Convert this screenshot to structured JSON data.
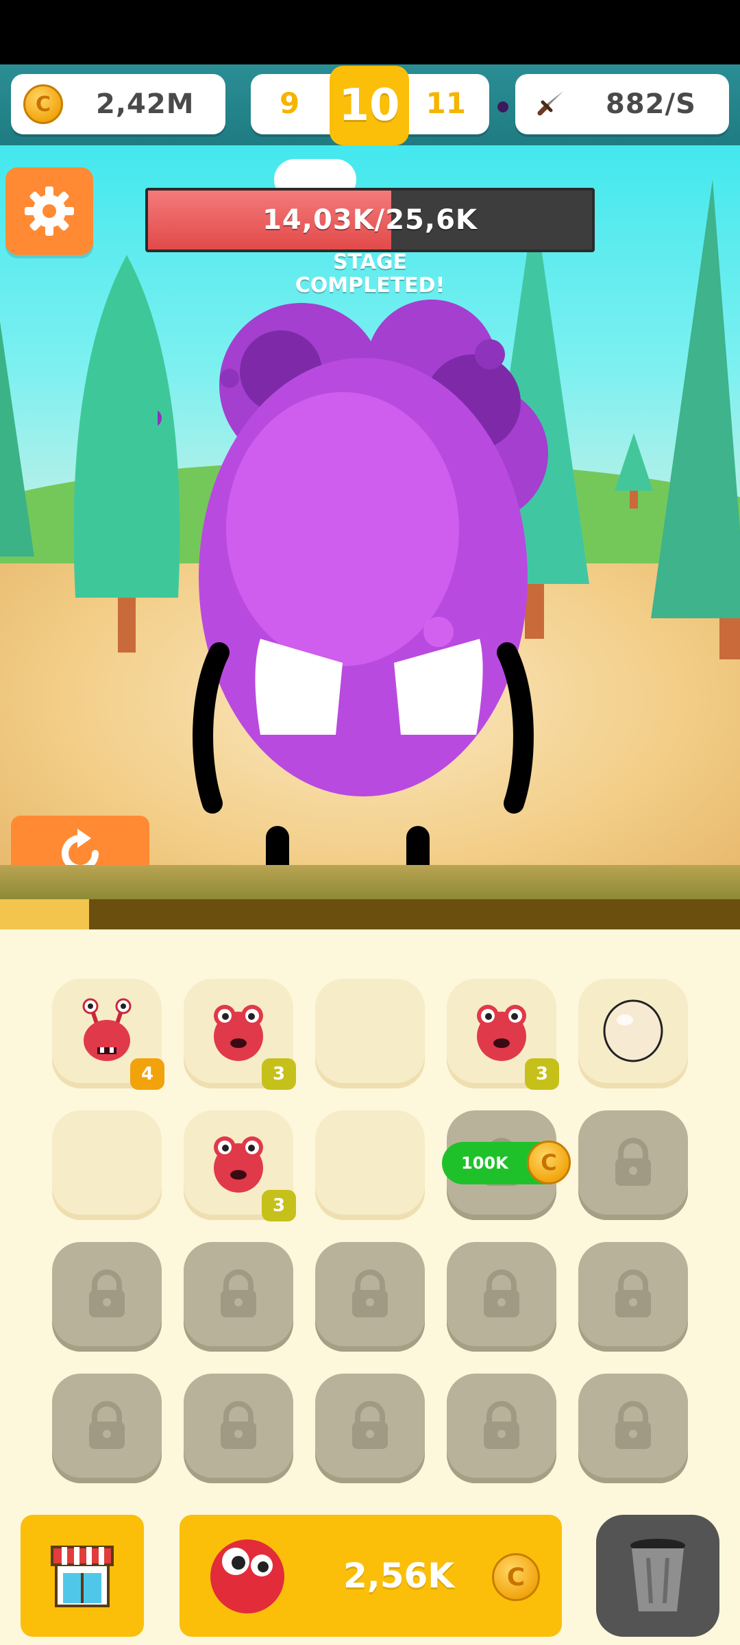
{
  "hud": {
    "coins": "2,42M",
    "coin_symbol": "C",
    "level_prev": "9",
    "level_current": "10",
    "level_next": "11",
    "dps": "882/S"
  },
  "boss": {
    "health_text": "14,03K/25,6K",
    "health_fraction": 0.548,
    "stage_line1": "STAGE",
    "stage_line2": "COMPLETED!"
  },
  "stage_progress_fraction": 0.12,
  "board": {
    "unlock_price": "100K",
    "slots": [
      {
        "state": "creature",
        "kind": "red-horn-monster",
        "level": "4"
      },
      {
        "state": "creature",
        "kind": "red-frog-monster",
        "level": "3"
      },
      {
        "state": "empty"
      },
      {
        "state": "creature",
        "kind": "red-frog-monster",
        "level": "3"
      },
      {
        "state": "egg"
      },
      {
        "state": "empty"
      },
      {
        "state": "creature",
        "kind": "red-frog-monster",
        "level": "3"
      },
      {
        "state": "empty"
      },
      {
        "state": "locked-purchasable"
      },
      {
        "state": "locked"
      },
      {
        "state": "locked"
      },
      {
        "state": "locked"
      },
      {
        "state": "locked"
      },
      {
        "state": "locked"
      },
      {
        "state": "locked"
      },
      {
        "state": "locked"
      },
      {
        "state": "locked"
      },
      {
        "state": "locked"
      },
      {
        "state": "locked"
      },
      {
        "state": "locked"
      }
    ]
  },
  "bottom_bar": {
    "buy_price": "2,56K"
  },
  "colors": {
    "accent_orange": "#ff8a33",
    "accent_yellow": "#fbbf0a",
    "hud_teal": "#2b8e95",
    "monster_purple": "#b94ae0"
  },
  "icons": [
    "gear-icon",
    "refresh-icon",
    "dagger-icon",
    "coin-icon",
    "shop-icon",
    "trash-icon",
    "lock-icon"
  ]
}
